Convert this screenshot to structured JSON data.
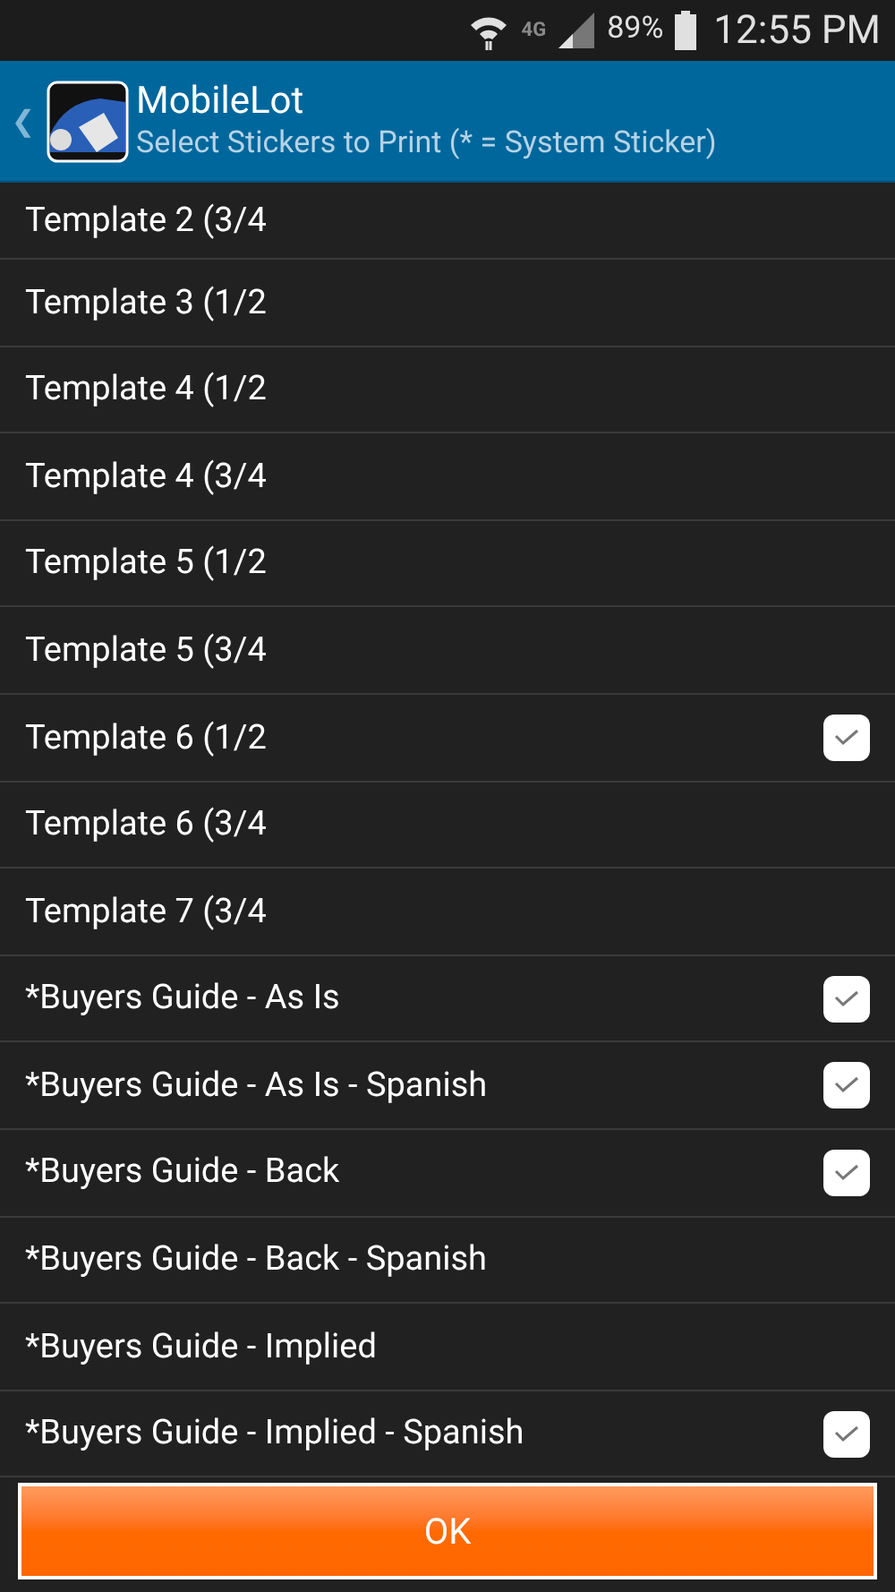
{
  "status_bar": {
    "network": "4G",
    "battery": "89%",
    "time": "12:55 PM"
  },
  "header": {
    "back": "❮",
    "title": "MobileLot",
    "subtitle": "Select Stickers to Print (* = System Sticker)"
  },
  "items": [
    {
      "label": "Template 2 (3/4",
      "checked": false
    },
    {
      "label": "Template 3 (1/2",
      "checked": false
    },
    {
      "label": "Template 4 (1/2",
      "checked": false
    },
    {
      "label": "Template 4 (3/4",
      "checked": false
    },
    {
      "label": "Template 5 (1/2",
      "checked": false
    },
    {
      "label": "Template 5 (3/4",
      "checked": false
    },
    {
      "label": "Template 6 (1/2",
      "checked": true
    },
    {
      "label": "Template 6 (3/4",
      "checked": false
    },
    {
      "label": "Template 7 (3/4",
      "checked": false
    },
    {
      "label": "*Buyers Guide - As Is",
      "checked": true
    },
    {
      "label": "*Buyers Guide - As Is - Spanish",
      "checked": true
    },
    {
      "label": "*Buyers Guide - Back",
      "checked": true
    },
    {
      "label": "*Buyers Guide - Back - Spanish",
      "checked": false
    },
    {
      "label": "*Buyers Guide - Implied",
      "checked": false
    },
    {
      "label": "*Buyers Guide - Implied - Spanish",
      "checked": true
    }
  ],
  "ok_button": "OK"
}
